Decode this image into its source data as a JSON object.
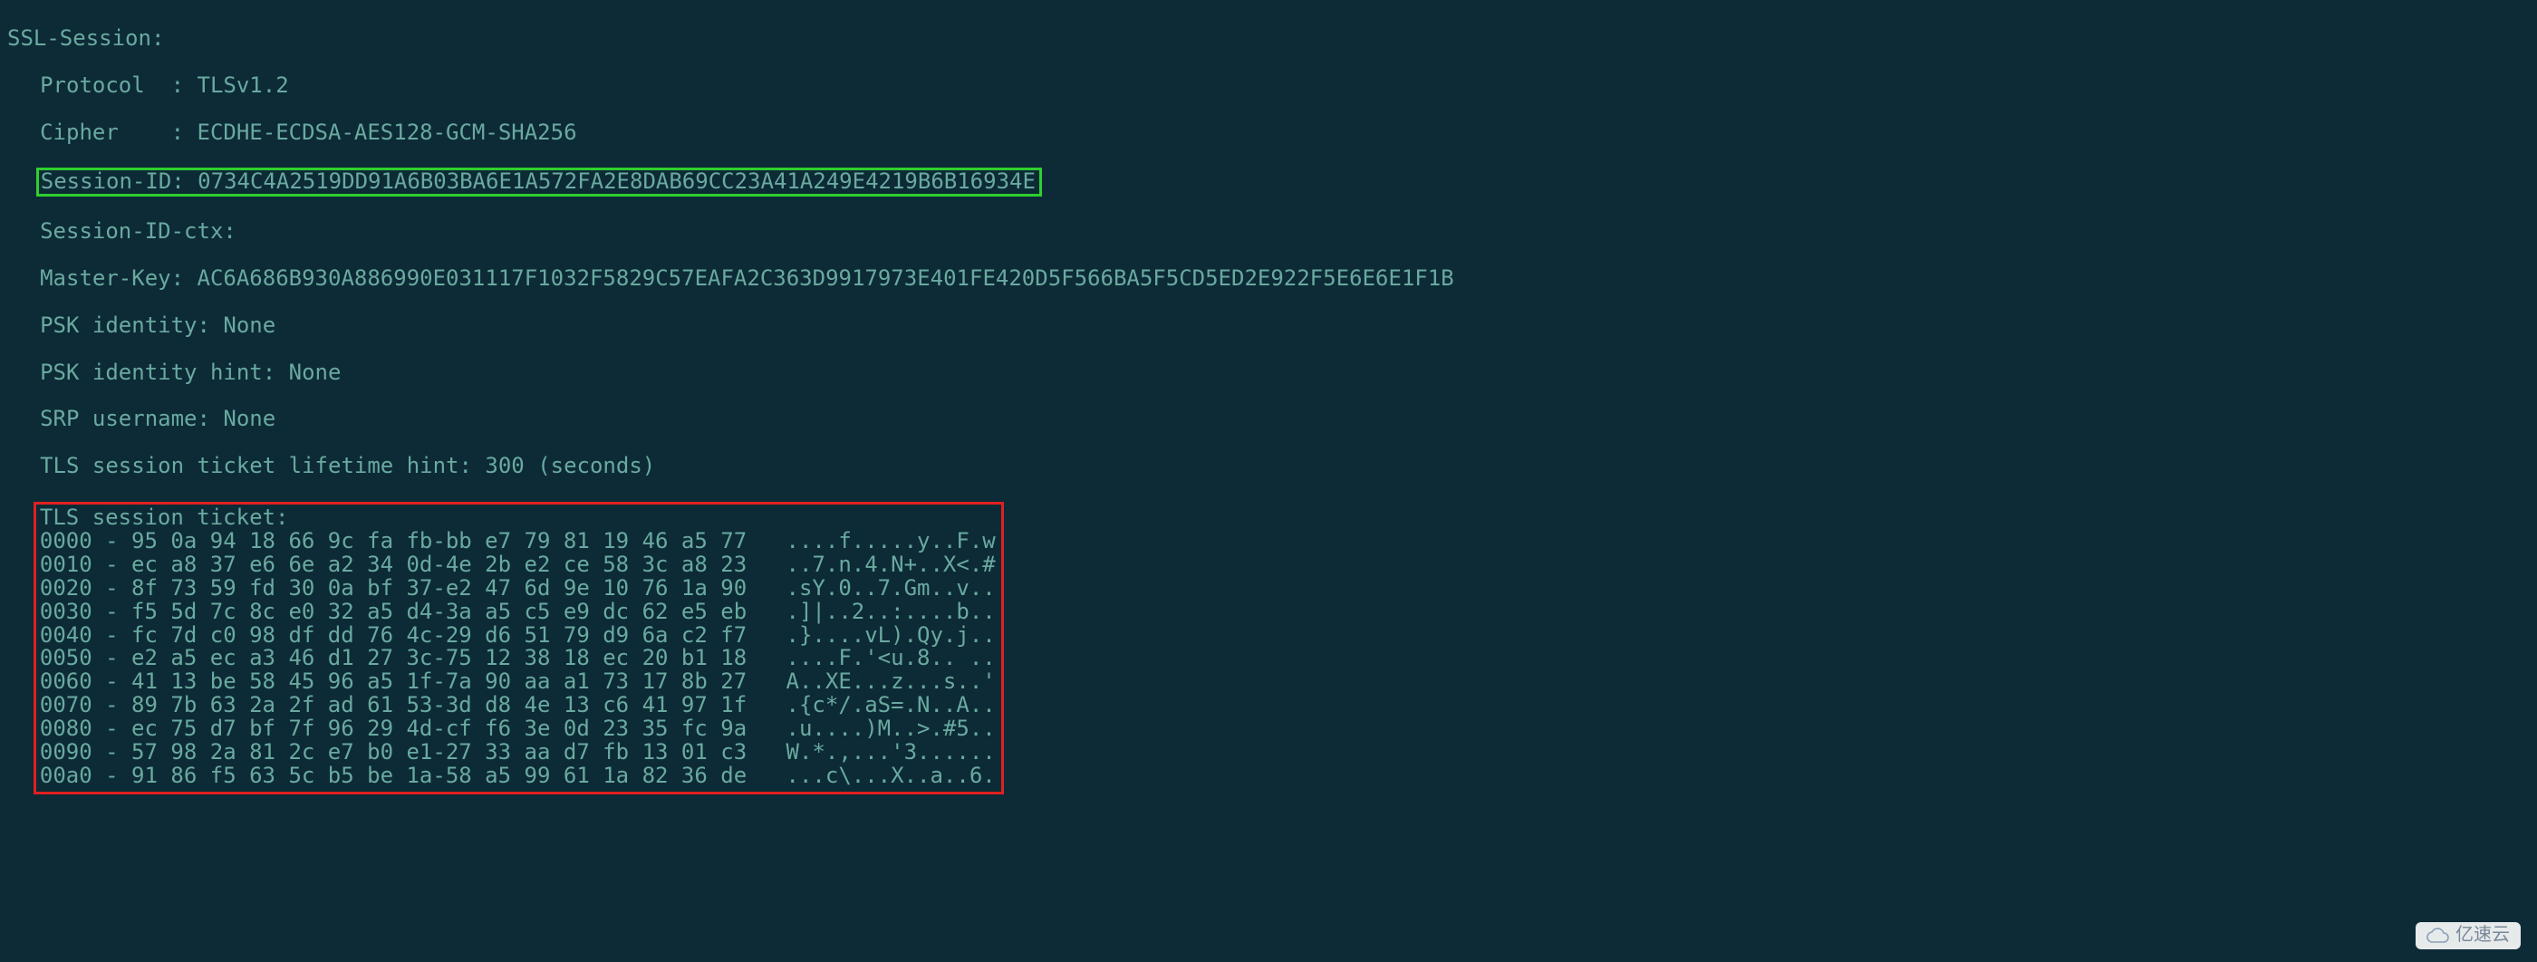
{
  "header": "SSL-Session:",
  "protocol": {
    "label": "Protocol  : ",
    "value": "TLSv1.2"
  },
  "cipher": {
    "label": "Cipher    : ",
    "value": "ECDHE-ECDSA-AES128-GCM-SHA256"
  },
  "session_id": {
    "label": "Session-ID: ",
    "value": "0734C4A2519DD91A6B03BA6E1A572FA2E8DAB69CC23A41A249E4219B6B16934E"
  },
  "session_id_ctx": {
    "label": "Session-ID-ctx:",
    "value": ""
  },
  "master_key": {
    "label": "Master-Key: ",
    "value": "AC6A686B930A886990E031117F1032F5829C57EAFA2C363D9917973E401FE420D5F566BA5F5CD5ED2E922F5E6E6E1F1B"
  },
  "psk_identity": {
    "label": "PSK identity: ",
    "value": "None"
  },
  "psk_identity_hint": {
    "label": "PSK identity hint: ",
    "value": "None"
  },
  "srp_username": {
    "label": "SRP username: ",
    "value": "None"
  },
  "ticket_lifetime": {
    "label": "TLS session ticket lifetime hint: ",
    "value": "300 (seconds)"
  },
  "ticket_header": "TLS session ticket:",
  "ticket_rows": [
    {
      "off": "0000",
      "hex": "95 0a 94 18 66 9c fa fb-bb e7 79 81 19 46 a5 77",
      "ascii": "....f.....y..F.w"
    },
    {
      "off": "0010",
      "hex": "ec a8 37 e6 6e a2 34 0d-4e 2b e2 ce 58 3c a8 23",
      "ascii": "..7.n.4.N+..X<.#"
    },
    {
      "off": "0020",
      "hex": "8f 73 59 fd 30 0a bf 37-e2 47 6d 9e 10 76 1a 90",
      "ascii": ".sY.0..7.Gm..v.."
    },
    {
      "off": "0030",
      "hex": "f5 5d 7c 8c e0 32 a5 d4-3a a5 c5 e9 dc 62 e5 eb",
      "ascii": ".]|..2..:....b.."
    },
    {
      "off": "0040",
      "hex": "fc 7d c0 98 df dd 76 4c-29 d6 51 79 d9 6a c2 f7",
      "ascii": ".}....vL).Qy.j.."
    },
    {
      "off": "0050",
      "hex": "e2 a5 ec a3 46 d1 27 3c-75 12 38 18 ec 20 b1 18",
      "ascii": "....F.'<u.8.. .."
    },
    {
      "off": "0060",
      "hex": "41 13 be 58 45 96 a5 1f-7a 90 aa a1 73 17 8b 27",
      "ascii": "A..XE...z...s..'"
    },
    {
      "off": "0070",
      "hex": "89 7b 63 2a 2f ad 61 53-3d d8 4e 13 c6 41 97 1f",
      "ascii": ".{c*/.aS=.N..A.."
    },
    {
      "off": "0080",
      "hex": "ec 75 d7 bf 7f 96 29 4d-cf f6 3e 0d 23 35 fc 9a",
      "ascii": ".u....)M..>.#5.."
    },
    {
      "off": "0090",
      "hex": "57 98 2a 81 2c e7 b0 e1-27 33 aa d7 fb 13 01 c3",
      "ascii": "W.*.,...'3......"
    },
    {
      "off": "00a0",
      "hex": "91 86 f5 63 5c b5 be 1a-58 a5 99 61 1a 82 36 de",
      "ascii": "...c\\...X..a..6."
    }
  ],
  "watermark": "亿速云"
}
